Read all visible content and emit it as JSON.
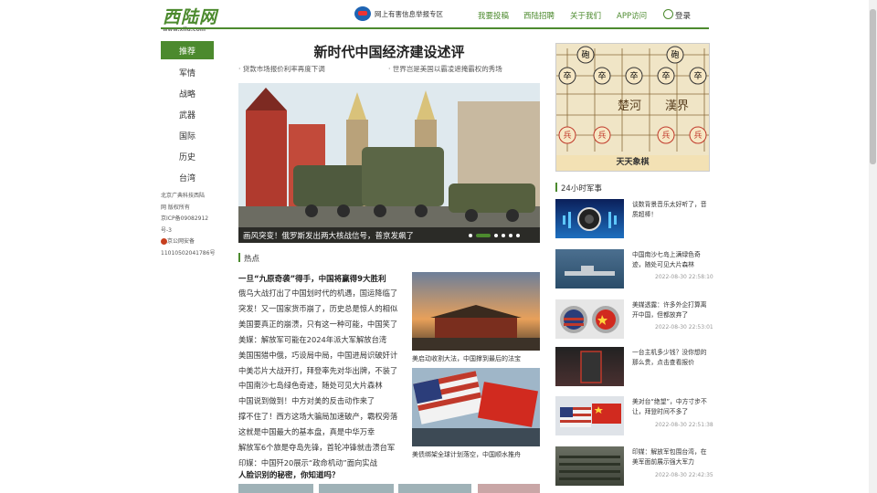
{
  "header": {
    "logo_text": "西陆网",
    "logo_sub": "www.xilu.com",
    "report_text": "网上有害信息举报专区",
    "nav": [
      "我要投稿",
      "西陆招聘",
      "关于我们",
      "APP访问"
    ],
    "login": "登录",
    "brand_color": "#4c8a2e"
  },
  "sidebar": {
    "items": [
      "推荐",
      "军情",
      "战略",
      "武器",
      "国际",
      "历史",
      "台湾"
    ],
    "footer": [
      "北京广典科技西陆",
      "网 版权所有",
      "京ICP备09082912",
      "号-3",
      "京公网安备",
      "11010502041786号"
    ]
  },
  "main": {
    "headline": "新时代中国经济建设述评",
    "sub_links": [
      "贷款市场报价利率再度下调",
      "世界岂是美国以霸凌遮掩霸权的秀场"
    ],
    "hero_caption": "画风突变！俄罗斯发出两大核战信号，普京发飙了",
    "hot_section": "热点",
    "hot_title": "一旦“九原奇袭”得手，中国将赢得9大胜利",
    "hot_list": [
      "俄乌大战打出了中国划时代的机遇，国运降临了",
      "突发！又一国家货币崩了，历史总是惊人的相似",
      "美国要真正的崩溃，只有这一种可能，中国笑了",
      "美媒：解放军可能在2024年派大军解放台湾",
      "美国围猎中俄，巧设局中局，中国进局识破奸计",
      "中美芯片大战开打，拜登率先对华出牌，不装了",
      "中国南沙七岛绿色奇迹，随处可见大片森林",
      "中国说到做到！中方对美的反击动作来了",
      "撑不住了！西方这场大骗局加速破产，霸权旁落",
      "这就是中国最大的基本盘，真是中华万幸",
      "解放军6个旅是夺岛先锋，首轮冲锋就击溃台军",
      "印媒：中国歼20展示“政命机动”面向实战"
    ],
    "thumb_captions": [
      "美启动收割大法，中国撑到最后的法宝",
      "美债绑架全球计划落空，中国顺水推舟"
    ],
    "question_title": "人脸识别的秘密，你知道吗？"
  },
  "right": {
    "chess_label": "天天象棋",
    "chess_text": [
      "楚河",
      "漢界"
    ],
    "chess_pieces": [
      "砲",
      "卒",
      "卒",
      "卒",
      "卒",
      "卒",
      "兵",
      "兵",
      "兵",
      "兵",
      "砲"
    ],
    "section_title": "24小时军事",
    "news": [
      {
        "title": "谈数背景音乐太好听了，音质超棒！",
        "date": ""
      },
      {
        "title": "中国南沙七岛上满绿色奇迹，随处可见大片森林",
        "date": "2022-08-30 22:58:10"
      },
      {
        "title": "美媒透露：许多外企打算离开中国，但都放弃了",
        "date": "2022-08-30 22:53:01"
      },
      {
        "title": "一台主机多少钱？没你想的那么贵，点击查看报价",
        "date": ""
      },
      {
        "title": "美对台“绝望”，中方寸步不让，拜登时间不多了",
        "date": "2022-08-30 22:51:38"
      },
      {
        "title": "印媒：解放军包围台湾，在美军面前展示强大军力",
        "date": "2022-08-30 22:42:35"
      }
    ]
  }
}
